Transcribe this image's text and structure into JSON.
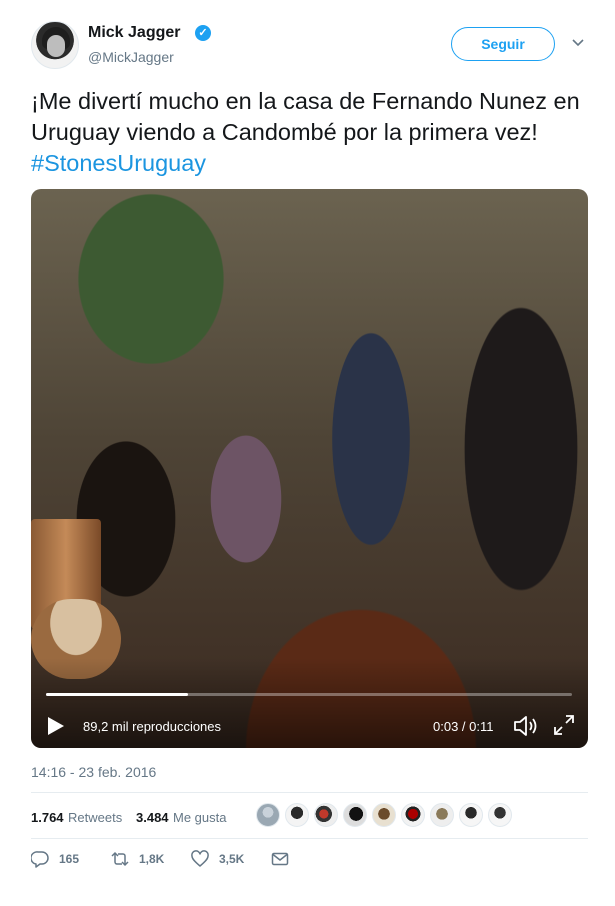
{
  "author": {
    "name": "Mick Jagger",
    "handle": "@MickJagger",
    "avatar_icon": "profile-photo-icon",
    "verified_icon": "verified-badge-icon"
  },
  "follow_button": {
    "label": "Seguir"
  },
  "menu_icon": "chevron-down-icon",
  "tweet": {
    "text_main": "¡Me divertí mucho en la casa de Fernando Nunez en Uruguay viendo a Candombé por la primera vez!",
    "hashtag": "#StonesUruguay"
  },
  "video": {
    "views": "89,2 mil reproducciones",
    "time": "0:03 / 0:11",
    "progress_fraction": 0.27,
    "play_icon": "play-icon",
    "volume_icon": "volume-icon",
    "fullscreen_icon": "fullscreen-icon"
  },
  "timestamp": "14:16 - 23 feb. 2016",
  "stats": {
    "retweets_count": "1.764",
    "retweets_label": "Retweets",
    "likes_count": "3.484",
    "likes_label": "Me gusta"
  },
  "actions": {
    "reply_count": "165",
    "retweet_count": "1,8K",
    "like_count": "3,5K"
  },
  "colors": {
    "accent": "#1da1f2",
    "hashtag": "#1b95e0",
    "secondary_text": "#657786"
  }
}
